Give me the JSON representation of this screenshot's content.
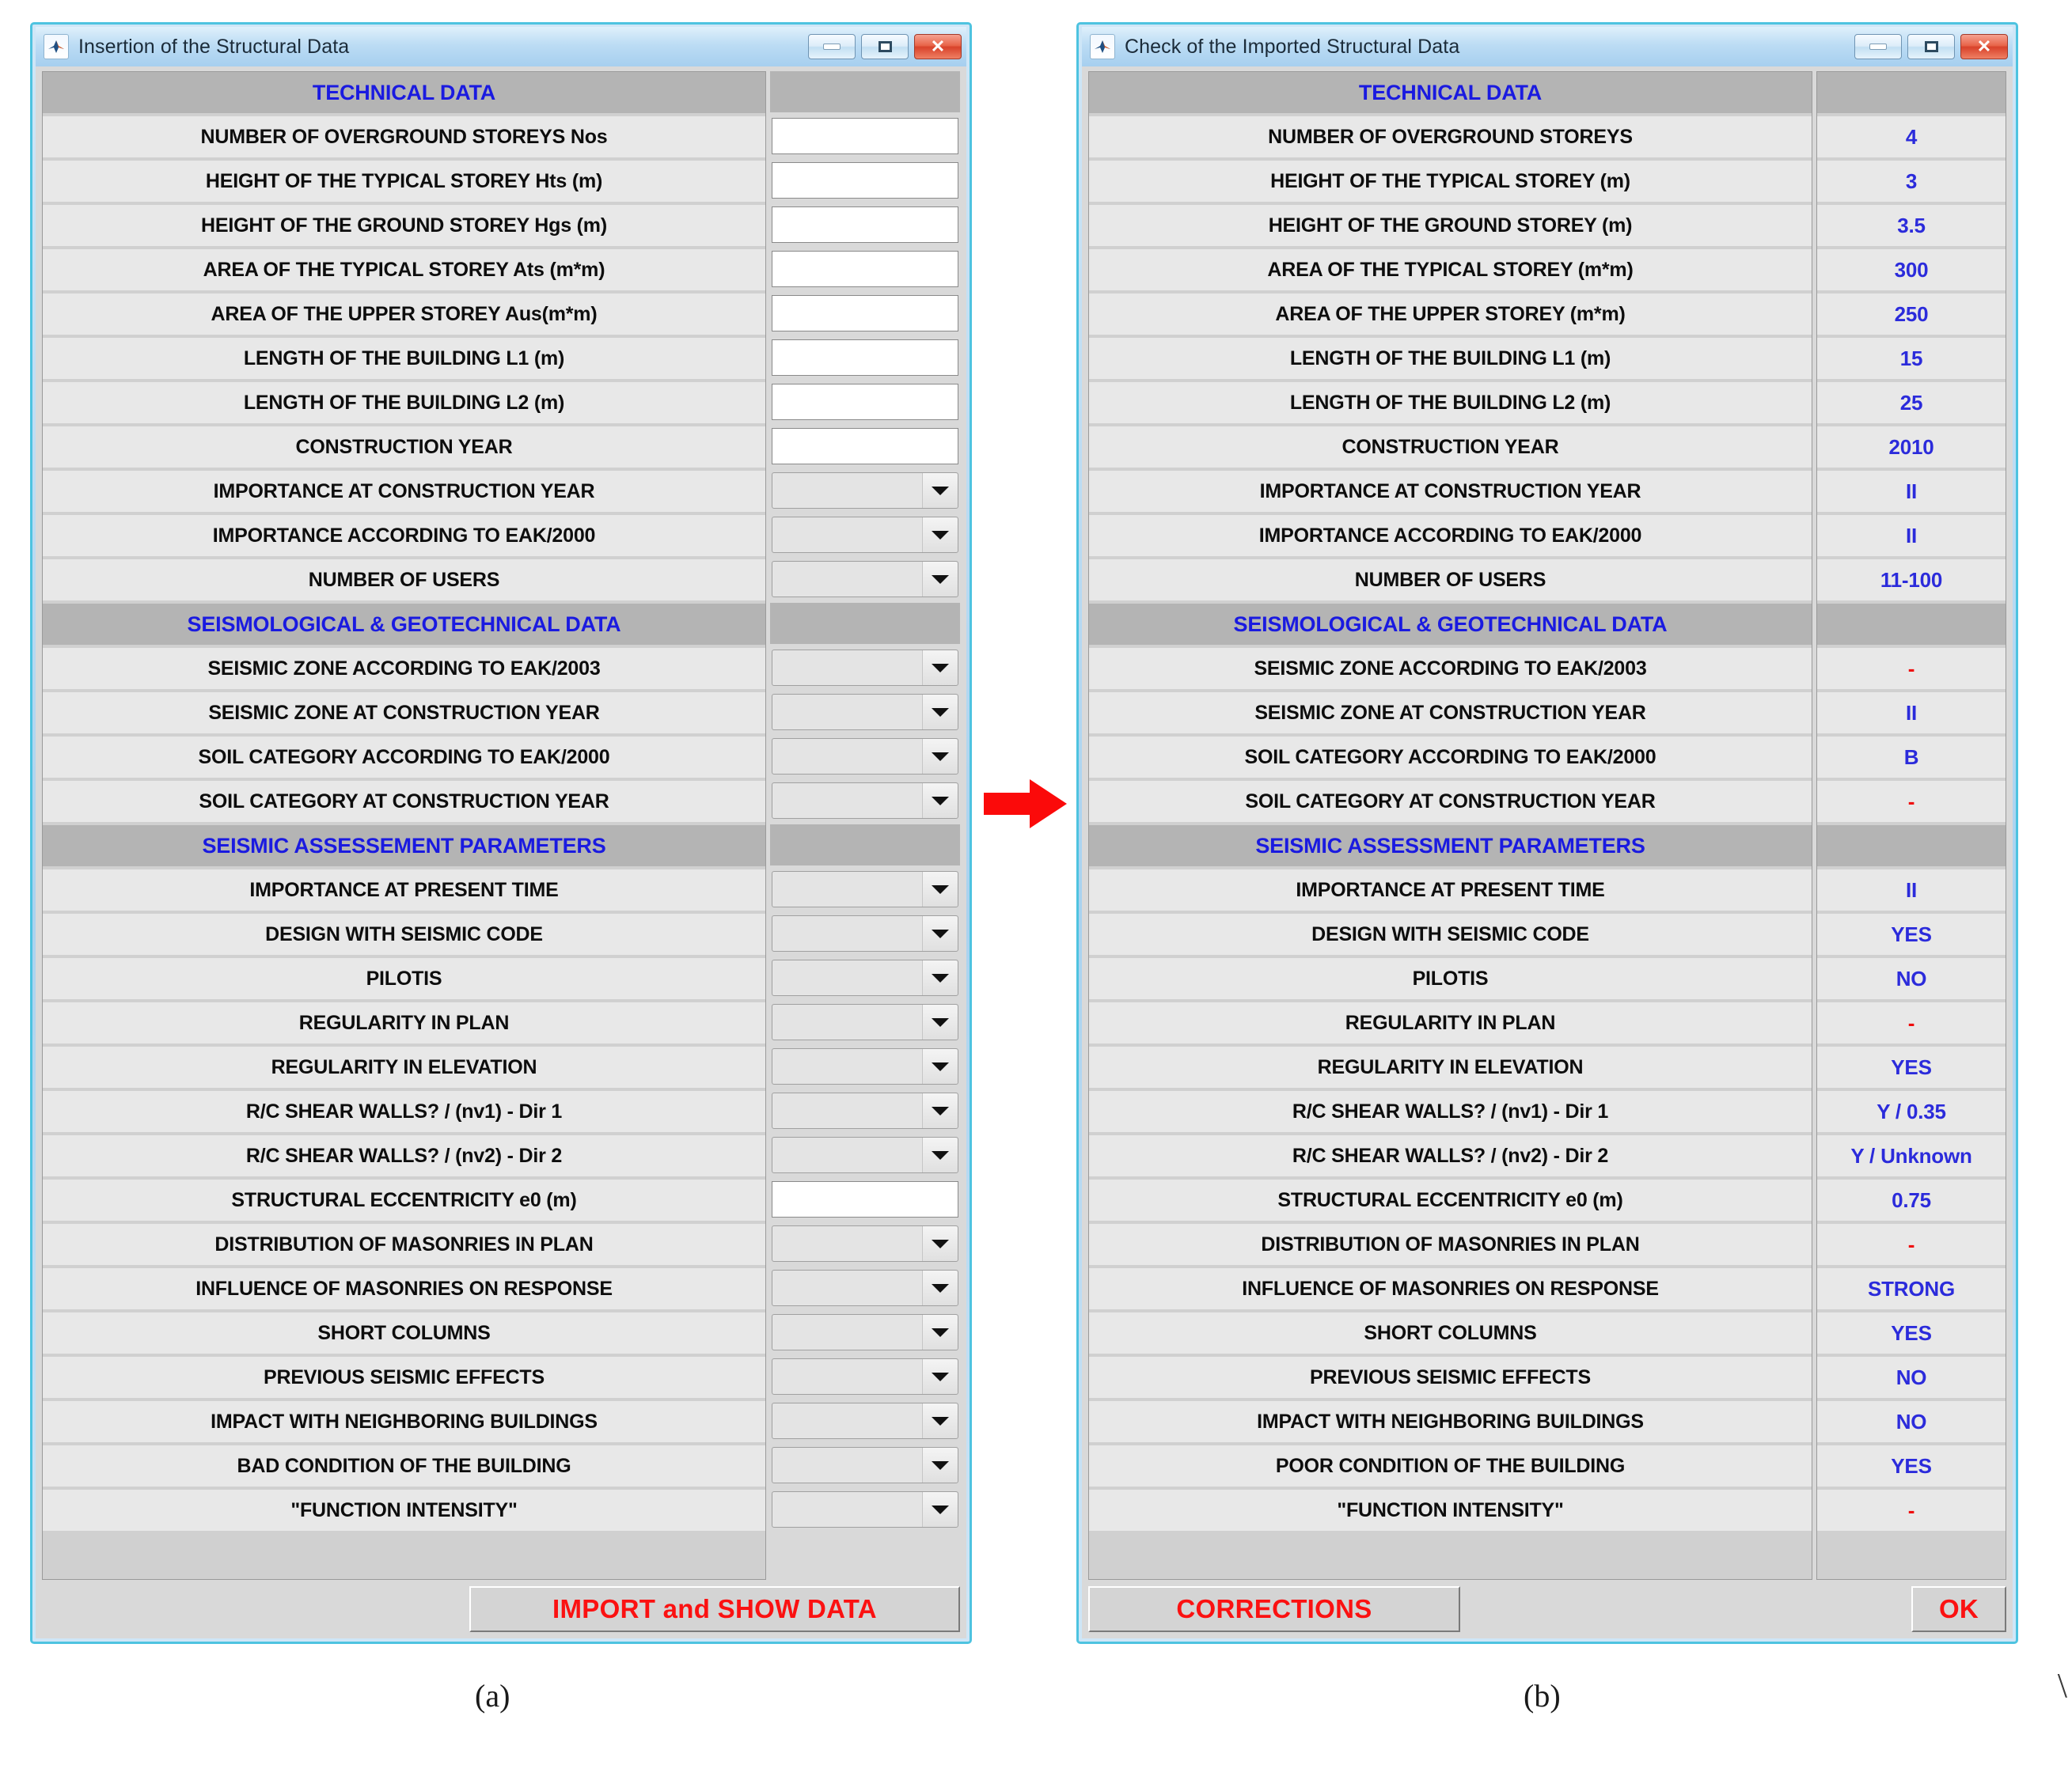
{
  "left_window": {
    "title": "Insertion of the Structural Data",
    "icon": "matlab-app-icon",
    "controls": {
      "minimize": "minimize-button",
      "maximize": "maximize-button",
      "close": "close-button",
      "close_glyph": "✕"
    },
    "rows": [
      {
        "type": "section",
        "label": "TECHNICAL DATA"
      },
      {
        "type": "text",
        "label": "NUMBER OF OVERGROUND STOREYS Nos",
        "value": ""
      },
      {
        "type": "text",
        "label": "HEIGHT OF THE TYPICAL STOREY Hts (m)",
        "value": ""
      },
      {
        "type": "text",
        "label": "HEIGHT OF THE GROUND STOREY Hgs (m)",
        "value": ""
      },
      {
        "type": "text",
        "label": "AREA OF THE TYPICAL STOREY Ats (m*m)",
        "value": ""
      },
      {
        "type": "text",
        "label": "AREA OF THE UPPER STOREY Aus(m*m)",
        "value": ""
      },
      {
        "type": "text",
        "label": "LENGTH OF THE BUILDING L1 (m)",
        "value": ""
      },
      {
        "type": "text",
        "label": "LENGTH OF THE BUILDING L2 (m)",
        "value": ""
      },
      {
        "type": "text",
        "label": "CONSTRUCTION YEAR",
        "value": ""
      },
      {
        "type": "dropdown",
        "label": "IMPORTANCE AT CONSTRUCTION YEAR",
        "value": ""
      },
      {
        "type": "dropdown",
        "label": "IMPORTANCE ACCORDING TO EAK/2000",
        "value": ""
      },
      {
        "type": "dropdown",
        "label": "NUMBER OF USERS",
        "value": ""
      },
      {
        "type": "section",
        "label": "SEISMOLOGICAL & GEOTECHNICAL DATA"
      },
      {
        "type": "dropdown",
        "label": "SEISMIC ZONE ACCORDING TO EAK/2003",
        "value": ""
      },
      {
        "type": "dropdown",
        "label": "SEISMIC ZONE AT CONSTRUCTION YEAR",
        "value": ""
      },
      {
        "type": "dropdown",
        "label": "SOIL CATEGORY ACCORDING TO EAK/2000",
        "value": ""
      },
      {
        "type": "dropdown",
        "label": "SOIL CATEGORY AT CONSTRUCTION YEAR",
        "value": ""
      },
      {
        "type": "section",
        "label": "SEISMIC ASSESSEMENT PARAMETERS"
      },
      {
        "type": "dropdown",
        "label": "IMPORTANCE AT PRESENT TIME",
        "value": ""
      },
      {
        "type": "dropdown",
        "label": "DESIGN WITH SEISMIC CODE",
        "value": ""
      },
      {
        "type": "dropdown",
        "label": "PILOTIS",
        "value": ""
      },
      {
        "type": "dropdown",
        "label": "REGULARITY IN PLAN",
        "value": ""
      },
      {
        "type": "dropdown",
        "label": "REGULARITY IN ELEVATION",
        "value": ""
      },
      {
        "type": "dropdown",
        "label": "R/C SHEAR WALLS? / (nv1) - Dir 1",
        "value": ""
      },
      {
        "type": "dropdown",
        "label": "R/C SHEAR WALLS? / (nv2) - Dir 2",
        "value": ""
      },
      {
        "type": "text",
        "label": "STRUCTURAL ECCENTRICITY e0 (m)",
        "value": ""
      },
      {
        "type": "dropdown",
        "label": "DISTRIBUTION OF MASONRIES IN PLAN",
        "value": ""
      },
      {
        "type": "dropdown",
        "label": "INFLUENCE OF MASONRIES ON RESPONSE",
        "value": ""
      },
      {
        "type": "dropdown",
        "label": "SHORT COLUMNS",
        "value": ""
      },
      {
        "type": "dropdown",
        "label": "PREVIOUS SEISMIC EFFECTS",
        "value": ""
      },
      {
        "type": "dropdown",
        "label": "IMPACT WITH NEIGHBORING BUILDINGS",
        "value": ""
      },
      {
        "type": "dropdown",
        "label": "BAD CONDITION OF THE BUILDING",
        "value": ""
      },
      {
        "type": "dropdown",
        "label": "\"FUNCTION INTENSITY\"",
        "value": ""
      }
    ],
    "import_button": "IMPORT and SHOW DATA"
  },
  "right_window": {
    "title": "Check of the Imported Structural Data",
    "icon": "matlab-app-icon",
    "controls": {
      "minimize": "minimize-button",
      "maximize": "maximize-button",
      "close": "close-button",
      "close_glyph": "✕"
    },
    "rows": [
      {
        "type": "section",
        "label": "TECHNICAL DATA",
        "value": ""
      },
      {
        "type": "value",
        "label": "NUMBER OF OVERGROUND STOREYS",
        "value": "4"
      },
      {
        "type": "value",
        "label": "HEIGHT OF THE TYPICAL STOREY (m)",
        "value": "3"
      },
      {
        "type": "value",
        "label": "HEIGHT OF THE GROUND STOREY (m)",
        "value": "3.5"
      },
      {
        "type": "value",
        "label": "AREA OF THE TYPICAL STOREY (m*m)",
        "value": "300"
      },
      {
        "type": "value",
        "label": "AREA OF THE UPPER STOREY (m*m)",
        "value": "250"
      },
      {
        "type": "value",
        "label": "LENGTH OF THE BUILDING L1 (m)",
        "value": "15"
      },
      {
        "type": "value",
        "label": "LENGTH OF THE BUILDING L2 (m)",
        "value": "25"
      },
      {
        "type": "value",
        "label": "CONSTRUCTION YEAR",
        "value": "2010"
      },
      {
        "type": "value",
        "label": "IMPORTANCE AT CONSTRUCTION YEAR",
        "value": "II"
      },
      {
        "type": "value",
        "label": "IMPORTANCE ACCORDING TO EAK/2000",
        "value": "II"
      },
      {
        "type": "value",
        "label": "NUMBER OF USERS",
        "value": "11-100"
      },
      {
        "type": "section",
        "label": "SEISMOLOGICAL & GEOTECHNICAL DATA",
        "value": ""
      },
      {
        "type": "value",
        "label": "SEISMIC ZONE ACCORDING TO EAK/2003",
        "value": "-",
        "missing": true
      },
      {
        "type": "value",
        "label": "SEISMIC ZONE AT CONSTRUCTION YEAR",
        "value": "II"
      },
      {
        "type": "value",
        "label": "SOIL CATEGORY ACCORDING TO EAK/2000",
        "value": "B"
      },
      {
        "type": "value",
        "label": "SOIL CATEGORY AT CONSTRUCTION YEAR",
        "value": "-",
        "missing": true
      },
      {
        "type": "section",
        "label": "SEISMIC ASSESSMENT PARAMETERS",
        "value": ""
      },
      {
        "type": "value",
        "label": "IMPORTANCE AT PRESENT TIME",
        "value": "II"
      },
      {
        "type": "value",
        "label": "DESIGN WITH SEISMIC CODE",
        "value": "YES"
      },
      {
        "type": "value",
        "label": "PILOTIS",
        "value": "NO"
      },
      {
        "type": "value",
        "label": "REGULARITY IN PLAN",
        "value": "-",
        "missing": true
      },
      {
        "type": "value",
        "label": "REGULARITY IN ELEVATION",
        "value": "YES"
      },
      {
        "type": "value",
        "label": "R/C SHEAR WALLS? / (nv1) - Dir 1",
        "value": "Y / 0.35"
      },
      {
        "type": "value",
        "label": "R/C SHEAR WALLS? / (nv2) - Dir 2",
        "value": "Y / Unknown"
      },
      {
        "type": "value",
        "label": "STRUCTURAL ECCENTRICITY e0 (m)",
        "value": "0.75"
      },
      {
        "type": "value",
        "label": "DISTRIBUTION OF MASONRIES IN PLAN",
        "value": "-",
        "missing": true
      },
      {
        "type": "value",
        "label": "INFLUENCE OF MASONRIES ON RESPONSE",
        "value": "STRONG"
      },
      {
        "type": "value",
        "label": "SHORT COLUMNS",
        "value": "YES"
      },
      {
        "type": "value",
        "label": "PREVIOUS SEISMIC EFFECTS",
        "value": "NO"
      },
      {
        "type": "value",
        "label": "IMPACT WITH NEIGHBORING BUILDINGS",
        "value": "NO"
      },
      {
        "type": "value",
        "label": "POOR CONDITION OF THE BUILDING",
        "value": "YES"
      },
      {
        "type": "value",
        "label": "\"FUNCTION INTENSITY\"",
        "value": "-",
        "missing": true
      }
    ],
    "corrections_button": "CORRECTIONS",
    "ok_button": "OK"
  },
  "figure": {
    "caption_a": "(a)",
    "caption_b": "(b)",
    "arrow": "right-arrow",
    "page_mark": "\\"
  },
  "colors": {
    "section_text": "#1a1ae0",
    "value_text": "#2b2bdb",
    "missing_text": "#ef0b0b",
    "button_text": "#fb1111",
    "arrow": "#fb0a0a",
    "window_border": "#4ec3e0",
    "row_bg": "#e8e8e8",
    "section_bg": "#b4b4b4"
  }
}
